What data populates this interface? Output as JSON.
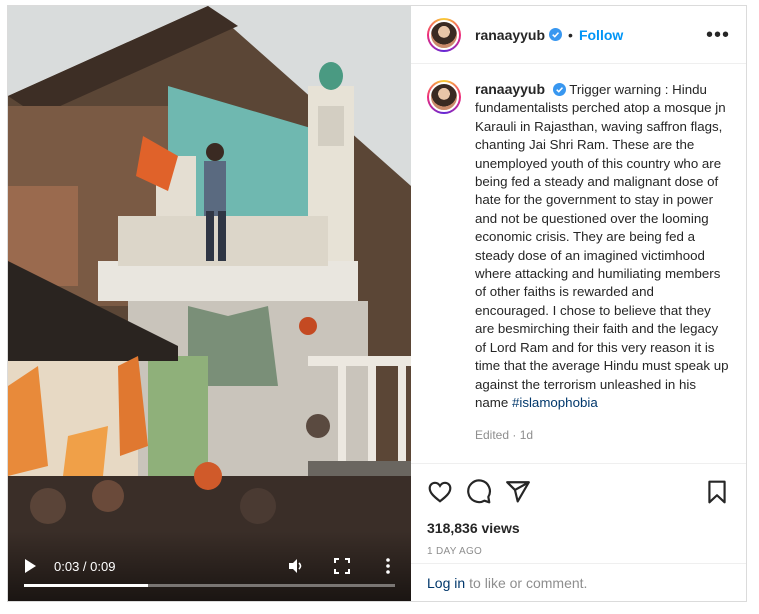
{
  "post": {
    "username": "ranaayyub",
    "follow_label": "Follow",
    "separator": "•",
    "more_icon": "more-horizontal-icon"
  },
  "caption": {
    "username": "ranaayyub",
    "text": "Trigger warning : Hindu fundamentalists perched atop a mosque jn Karauli in Rajasthan, waving saffron flags, chanting Jai Shri Ram. These are the unemployed youth of this country who are being fed a steady and malignant dose of hate for the government to stay in power and not be questioned over the looming economic crisis. They are being fed a steady dose of an imagined victimhood where attacking and humiliating members of other faiths is rewarded and encouraged. I chose to believe that they are besmirching their faith and the legacy of Lord Ram and for this very reason it is time that the average Hindu must speak up against the terrorism unleashed in his name",
    "hashtag": "#islamophobia",
    "edited": "Edited · 1d"
  },
  "video": {
    "time": "0:03 / 0:09",
    "progress": 0.333,
    "icons": [
      "play-icon",
      "volume-icon",
      "fullscreen-icon",
      "more-vertical-icon"
    ]
  },
  "stats": {
    "views": "318,836 views",
    "date": "1 DAY AGO"
  },
  "footer": {
    "login_link": "Log in",
    "login_text": "to like or comment."
  },
  "colors": {
    "accent": "#0095f6",
    "link": "#00376b",
    "muted": "#8e8e8e",
    "verified": "#3897f0"
  }
}
